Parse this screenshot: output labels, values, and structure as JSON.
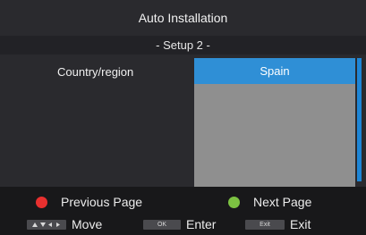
{
  "header": {
    "title": "Auto Installation",
    "subtitle": "- Setup 2 -"
  },
  "form": {
    "country_label": "Country/region",
    "country_value": "Spain"
  },
  "footer": {
    "previous_page": "Previous Page",
    "next_page": "Next Page",
    "move_label": "Move",
    "enter_key": "OK",
    "enter_label": "Enter",
    "exit_key": "Exit",
    "exit_label": "Exit"
  },
  "icons": {
    "red_button": "red-dot-icon",
    "green_button": "green-dot-icon",
    "arrows": "arrow-keys-icon"
  },
  "colors": {
    "selection": "#2f8fd6",
    "list_background": "#8f8f8f",
    "red": "#e8302f",
    "green": "#7cc242"
  }
}
